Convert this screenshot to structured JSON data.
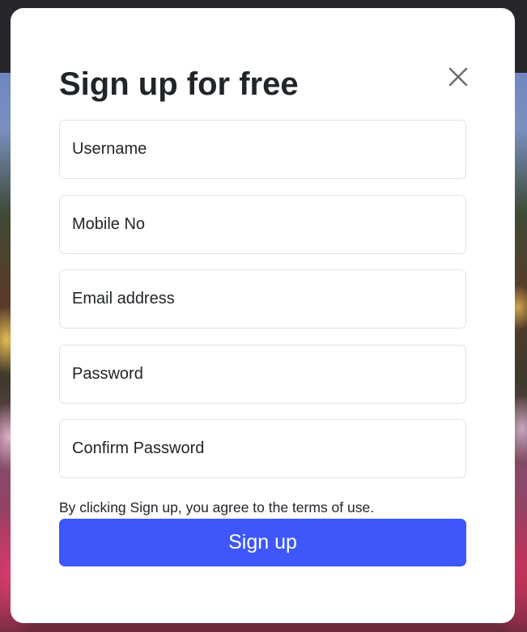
{
  "modal": {
    "title": "Sign up for free",
    "close_icon": "close-icon",
    "fields": {
      "username": {
        "placeholder": "Username",
        "value": ""
      },
      "mobile": {
        "placeholder": "Mobile No",
        "value": ""
      },
      "email": {
        "placeholder": "Email address",
        "value": ""
      },
      "password": {
        "placeholder": "Password",
        "value": ""
      },
      "confirm_password": {
        "placeholder": "Confirm Password",
        "value": ""
      }
    },
    "terms_text": "By clicking Sign up, you agree to the terms of use.",
    "submit_label": "Sign up"
  },
  "colors": {
    "primary": "#3d57fb",
    "text": "#212529",
    "field_border": "#dee2e6",
    "modal_bg": "#ffffff",
    "top_bar": "#25272c"
  }
}
